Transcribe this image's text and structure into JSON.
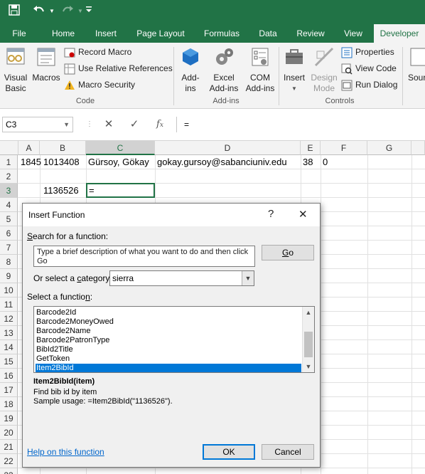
{
  "qat": {
    "save_icon": "save-icon",
    "undo_icon": "undo-icon",
    "redo_icon": "redo-icon",
    "customize_icon": "customize-qat-icon"
  },
  "tabs": [
    "File",
    "Home",
    "Insert",
    "Page Layout",
    "Formulas",
    "Data",
    "Review",
    "View",
    "Developer"
  ],
  "ribbon": {
    "code": {
      "visual_basic": "Visual\nBasic",
      "macros": "Macros",
      "record_macro": "Record Macro",
      "relative_refs": "Use Relative References",
      "macro_security": "Macro Security",
      "label": "Code"
    },
    "addins": {
      "addins": "Add-\nins",
      "excel_addins": "Excel\nAdd-ins",
      "com_addins": "COM\nAdd-ins",
      "label": "Add-ins"
    },
    "controls": {
      "insert": "Insert",
      "design_mode": "Design\nMode",
      "properties": "Properties",
      "view_code": "View Code",
      "run_dialog": "Run Dialog",
      "label": "Controls"
    },
    "source": "Sour"
  },
  "formula_bar": {
    "name_box": "C3",
    "formula": "="
  },
  "grid": {
    "columns": [
      "A",
      "B",
      "C",
      "D",
      "E",
      "F",
      "G"
    ],
    "rows": [
      "1",
      "2",
      "3",
      "4",
      "5",
      "6",
      "7",
      "8",
      "9",
      "10",
      "11",
      "12",
      "13",
      "14",
      "15",
      "16",
      "17",
      "18",
      "19",
      "20",
      "21",
      "22",
      "23"
    ],
    "cells": {
      "A1": "1845",
      "B1": "1013408",
      "C1": "Gürsoy, Gökay",
      "D1": "gokay.gursoy@sabanciuniv.edu",
      "E1": "38",
      "F1": "0",
      "B3": "1136526",
      "C3": "="
    }
  },
  "dialog": {
    "title": "Insert Function",
    "help_btn": "?",
    "close_btn": "✕",
    "search_label_pre": "",
    "search_label_u": "S",
    "search_label_post": "earch for a function:",
    "search_placeholder": "Type a brief description of what you want to do and then click Go",
    "go_label_u": "G",
    "go_label_post": "o",
    "category_label_pre": "Or select a ",
    "category_label_u": "c",
    "category_label_post": "ategory:",
    "category_value": "sierra",
    "select_label_pre": "Select a functio",
    "select_label_u": "n",
    "select_label_post": ":",
    "functions": [
      "Barcode2Id",
      "Barcode2MoneyOwed",
      "Barcode2Name",
      "Barcode2PatronType",
      "BibId2Title",
      "GetToken",
      "Item2BibId"
    ],
    "selected_function": "Item2BibId",
    "signature": "Item2BibId(item)",
    "description_line1": "Find bib id by item",
    "description_line2": "Sample usage: =Item2BibId(\"1136526\").",
    "help_link": "Help on this function",
    "ok": "OK",
    "cancel": "Cancel"
  },
  "colors": {
    "excel_green": "#217346",
    "selection_blue": "#0078d7",
    "link_blue": "#0066cc"
  }
}
